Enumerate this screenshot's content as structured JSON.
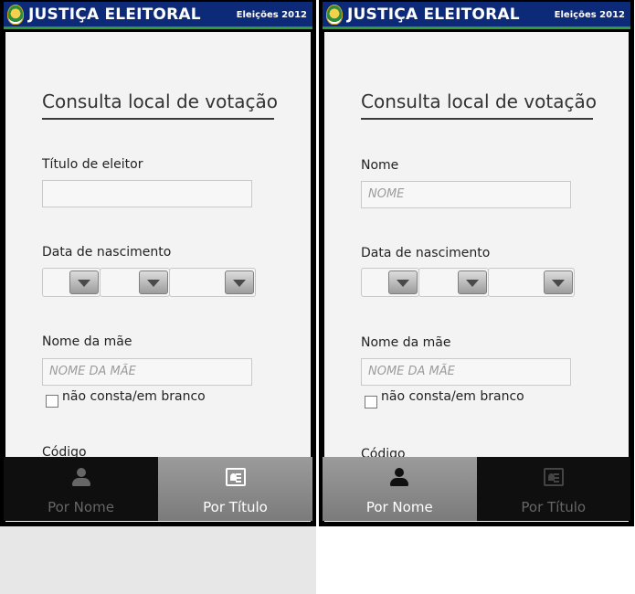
{
  "app": {
    "title": "JUSTIÇA ELEITORAL",
    "year_badge": "Eleições 2012"
  },
  "screens": [
    {
      "form_title": "Consulta local de votação",
      "first_field": {
        "label": "Título de eleitor",
        "value": "",
        "placeholder": ""
      },
      "birth_label": "Data de nascimento",
      "mother_field": {
        "label": "Nome da mãe",
        "placeholder": "NOME DA MÃE"
      },
      "checkbox_label": "não consta/em branco",
      "code_label": "Código",
      "tabs": [
        {
          "label": "Por Nome",
          "icon": "user-icon",
          "active": false
        },
        {
          "label": "Por Título",
          "icon": "voter-card-icon",
          "active": true
        }
      ]
    },
    {
      "form_title": "Consulta local de votação",
      "first_field": {
        "label": "Nome",
        "value": "",
        "placeholder": "NOME"
      },
      "birth_label": "Data de nascimento",
      "mother_field": {
        "label": "Nome da mãe",
        "placeholder": "NOME DA MÃE"
      },
      "checkbox_label": "não consta/em branco",
      "code_label": "Código",
      "tabs": [
        {
          "label": "Por Nome",
          "icon": "user-icon",
          "active": true
        },
        {
          "label": "Por Título",
          "icon": "voter-card-icon",
          "active": false
        }
      ]
    }
  ],
  "colors": {
    "header_blue": "#0d2a78",
    "header_green": "#2f9a3c",
    "tab_active": "#8a8a8a",
    "tab_inactive": "#0f0f0f"
  }
}
